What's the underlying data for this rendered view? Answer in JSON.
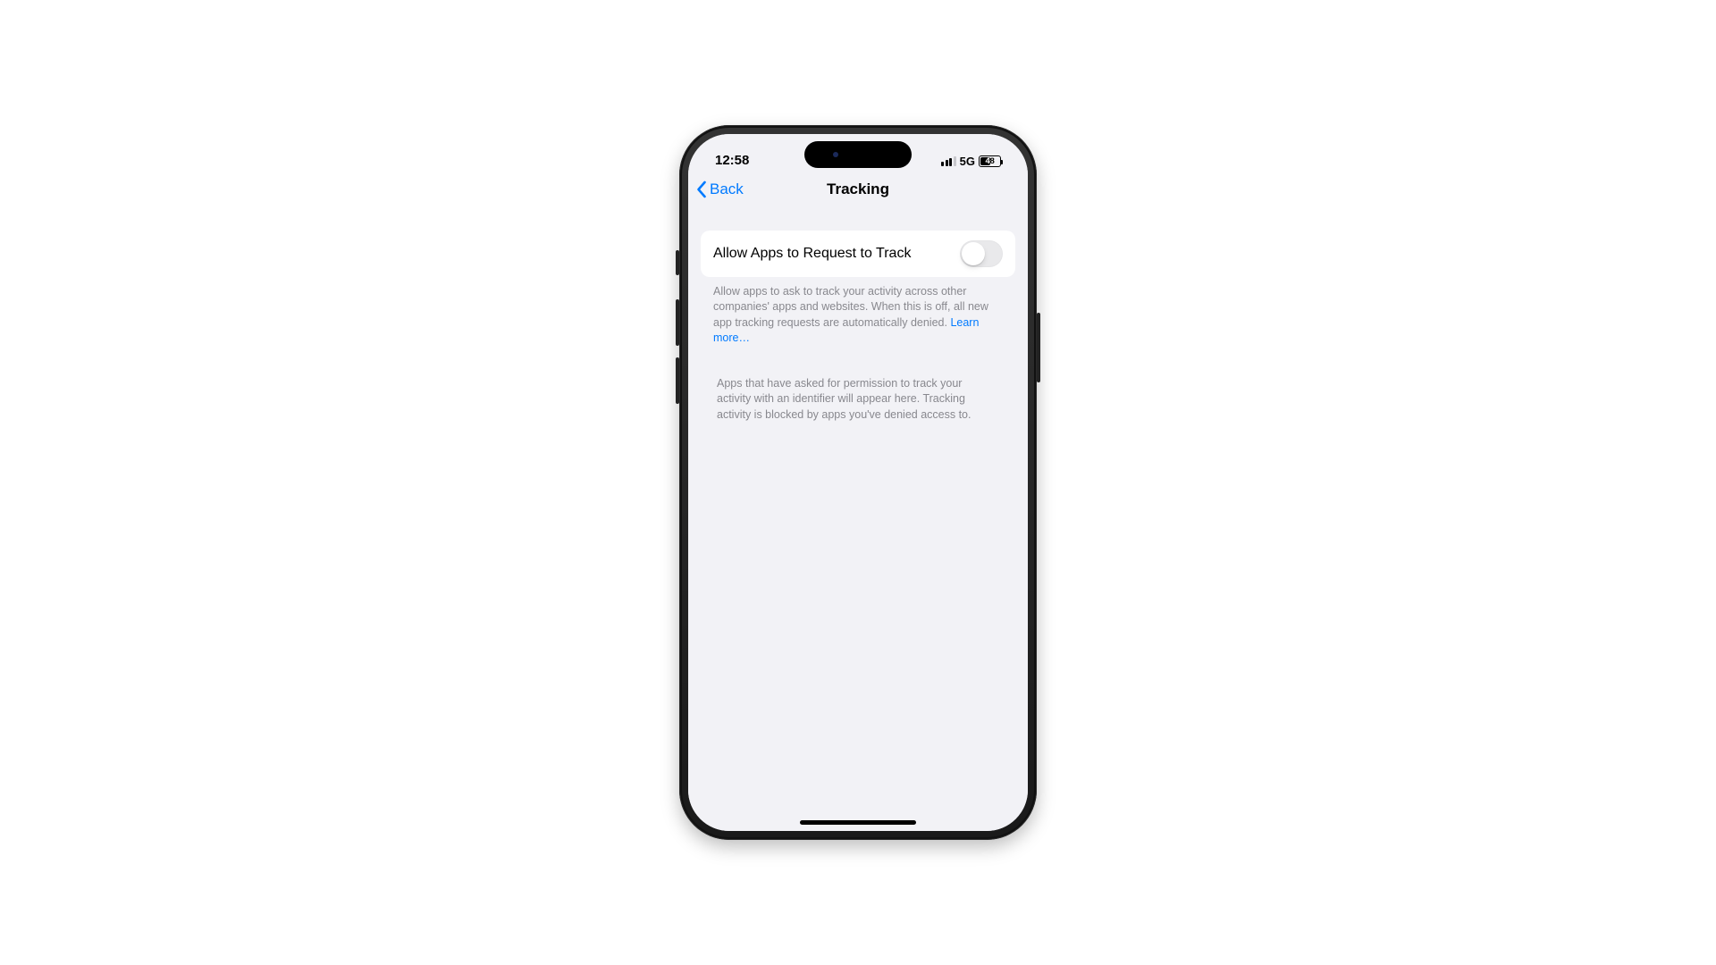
{
  "status": {
    "time": "12:58",
    "network": "5G",
    "battery_pct": "48"
  },
  "nav": {
    "back_label": "Back",
    "title": "Tracking"
  },
  "setting": {
    "label": "Allow Apps to Request to Track",
    "enabled": false
  },
  "explain": {
    "text": "Allow apps to ask to track your activity across other companies' apps and websites. When this is off, all new app tracking requests are automatically denied. ",
    "learn_more": "Learn more…"
  },
  "apps_note": "Apps that have asked for permission to track your activity with an identifier will appear here. Tracking activity is blocked by apps you've denied access to."
}
